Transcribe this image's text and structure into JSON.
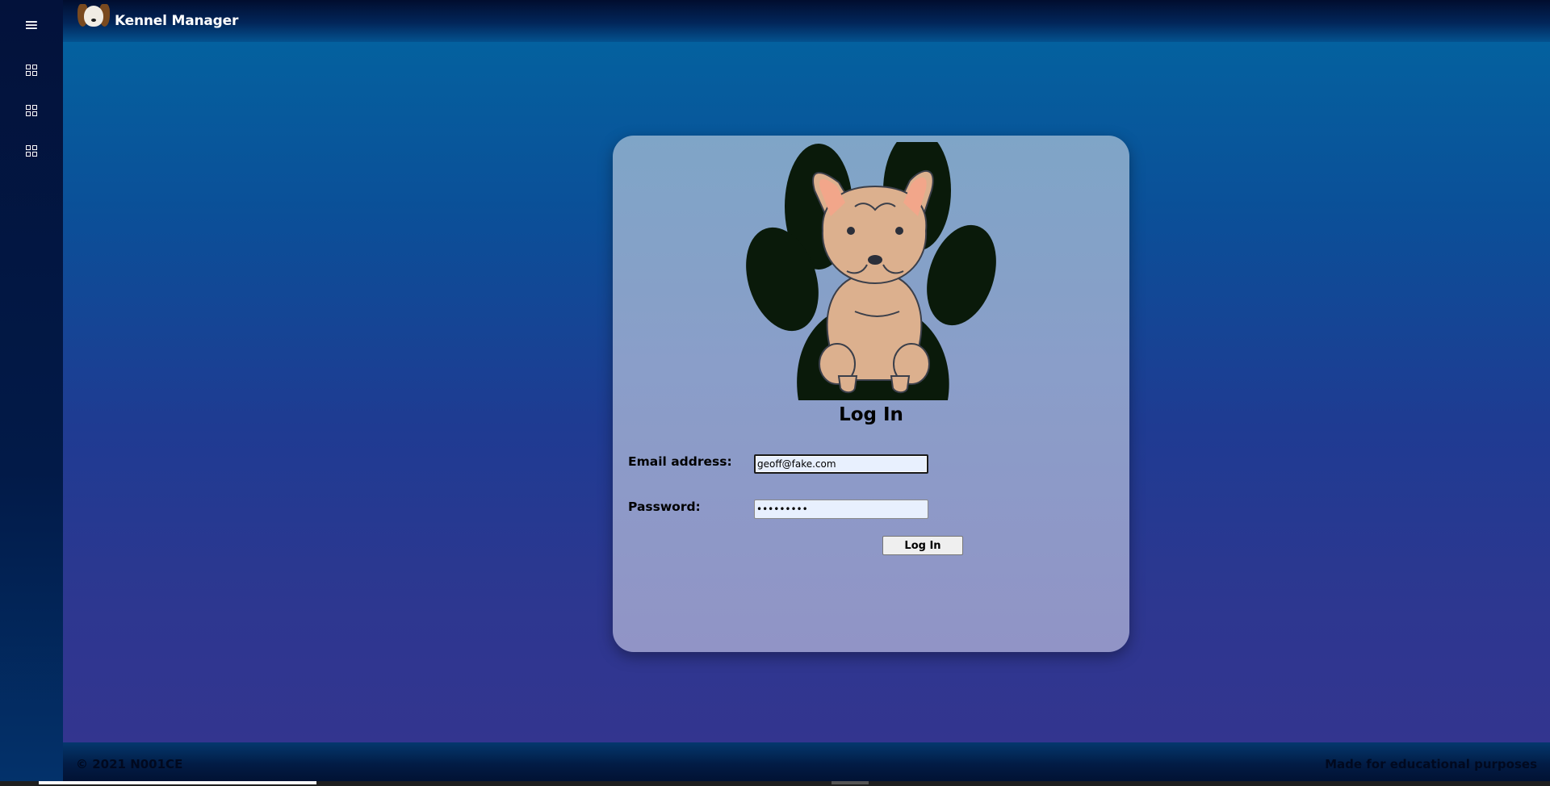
{
  "app": {
    "title": "Kennel Manager"
  },
  "sidebar": {
    "menu_icon": "hamburger-menu-icon",
    "items": [
      {
        "icon": "grid-icon"
      },
      {
        "icon": "grid-icon"
      },
      {
        "icon": "grid-icon"
      }
    ]
  },
  "login": {
    "title": "Log In",
    "email_label": "Email address:",
    "email_value": "geoff@fake.com",
    "password_label": "Password:",
    "password_value": "•••••••••",
    "submit_label": "Log In",
    "hero_image": "french-bulldog-paw-illustration"
  },
  "footer": {
    "copyright": "© 2021 N001CE",
    "note": "Made for educational purposes"
  },
  "colors": {
    "sidebar_bg": "#03123b",
    "main_top": "#04619f",
    "main_bottom": "#33358f",
    "card_top": "#7fa5c7",
    "card_bottom": "#9194c6"
  }
}
